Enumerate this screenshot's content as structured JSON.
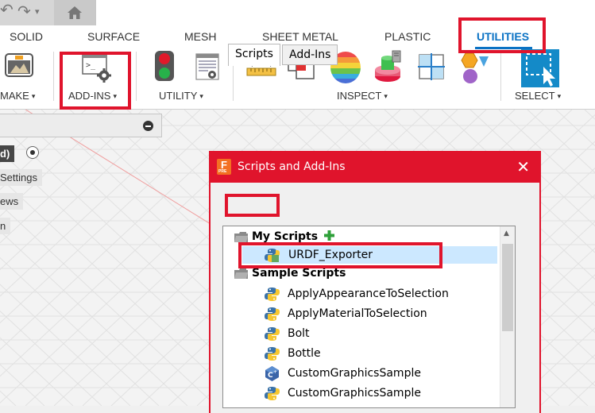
{
  "toolbar": {
    "tabs": [
      "SOLID",
      "SURFACE",
      "MESH",
      "SHEET METAL",
      "PLASTIC",
      "UTILITIES"
    ],
    "active_tab": "UTILITIES",
    "groups": {
      "make": "MAKE",
      "add_ins": "ADD-INS",
      "utility": "UTILITY",
      "inspect": "INSPECT",
      "select": "SELECT"
    }
  },
  "browser": {
    "items": [
      "d)",
      "Settings",
      "ews",
      "n"
    ]
  },
  "dialog": {
    "title": "Scripts and Add-Ins",
    "app_logo_letter": "F",
    "app_logo_sub": "PRE",
    "tabs": [
      "Scripts",
      "Add-Ins"
    ],
    "active_tab": "Scripts",
    "tree": {
      "my_scripts_label": "My Scripts",
      "my_scripts": [
        {
          "name": "URDF_Exporter",
          "icon": "python-icon",
          "selected": true
        }
      ],
      "sample_scripts_label": "Sample Scripts",
      "sample_scripts": [
        {
          "name": "ApplyAppearanceToSelection",
          "icon": "python-icon"
        },
        {
          "name": "ApplyMaterialToSelection",
          "icon": "python-icon"
        },
        {
          "name": "Bolt",
          "icon": "python-icon"
        },
        {
          "name": "Bottle",
          "icon": "python-icon"
        },
        {
          "name": "CustomGraphicsSample",
          "icon": "cpp-icon"
        },
        {
          "name": "CustomGraphicsSample",
          "icon": "python-icon"
        }
      ]
    }
  },
  "colors": {
    "highlight": "#e0142c",
    "accent_blue": "#0a72c4",
    "selection": "#cce8ff"
  }
}
